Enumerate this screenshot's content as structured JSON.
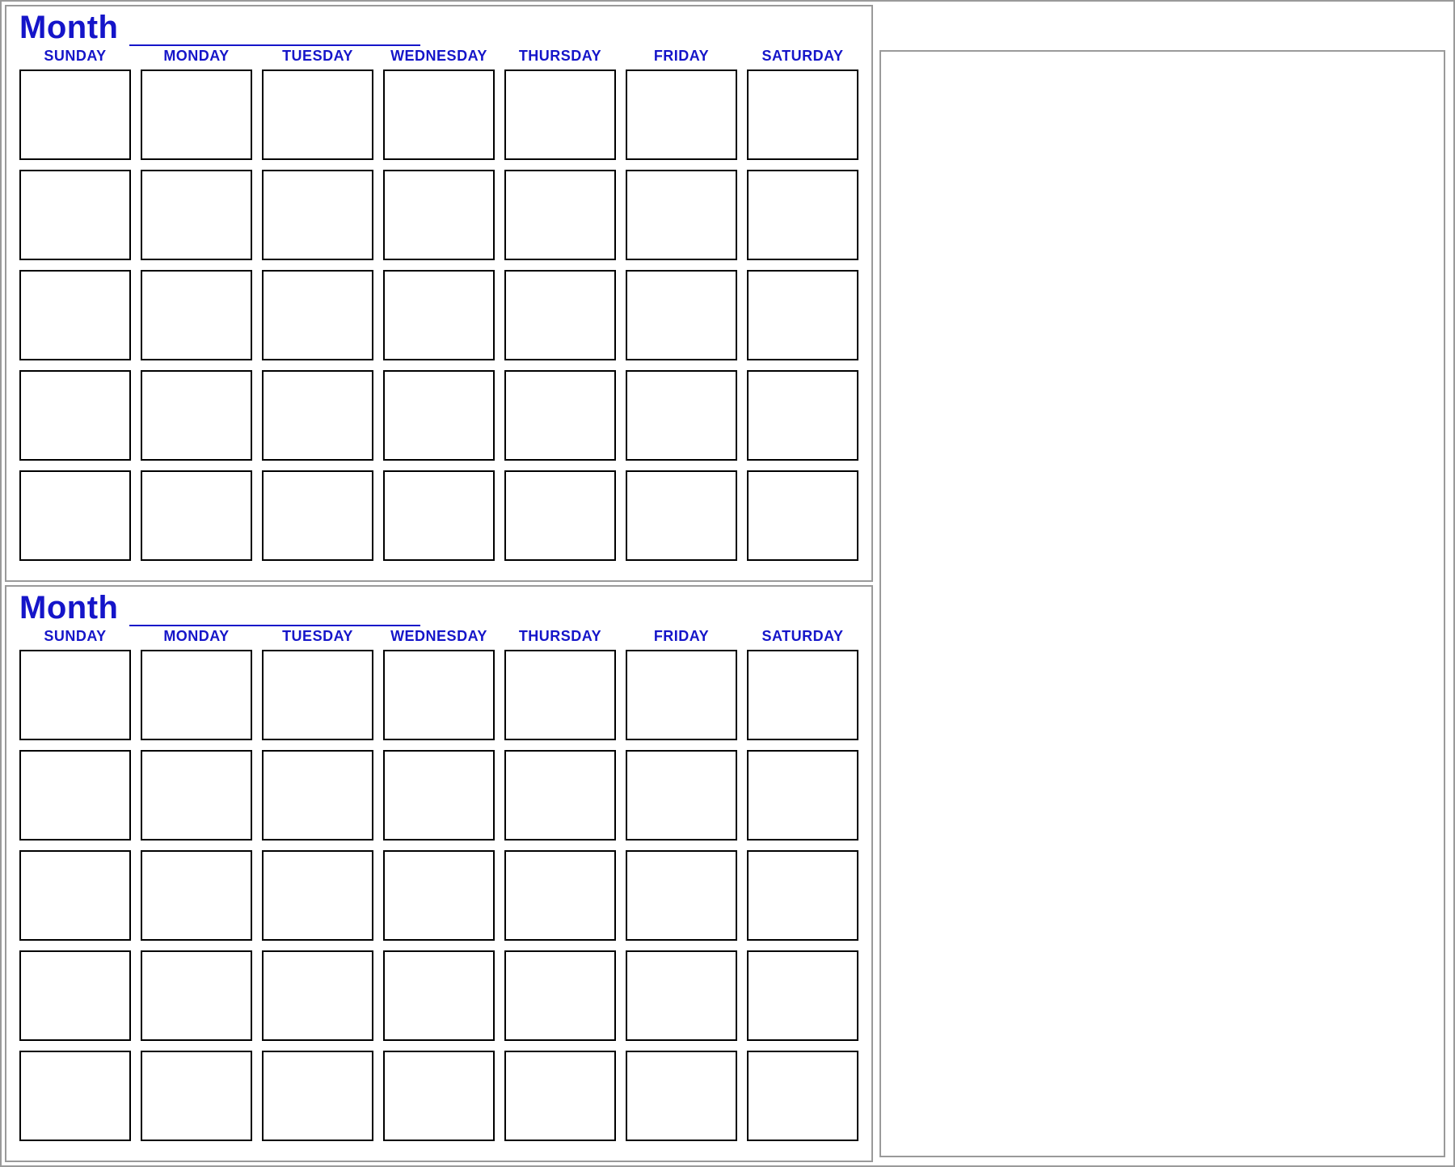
{
  "colors": {
    "accent": "#1515c9",
    "frame": "#9a9a9a",
    "cell_border": "#000000"
  },
  "month1": {
    "label": "Month",
    "name_value": "",
    "days": [
      "SUNDAY",
      "MONDAY",
      "TUESDAY",
      "WEDNESDAY",
      "THURSDAY",
      "FRIDAY",
      "SATURDAY"
    ],
    "rows": 5,
    "cols": 7
  },
  "month2": {
    "label": "Month",
    "name_value": "",
    "days": [
      "SUNDAY",
      "MONDAY",
      "TUESDAY",
      "WEDNESDAY",
      "THURSDAY",
      "FRIDAY",
      "SATURDAY"
    ],
    "rows": 5,
    "cols": 7
  },
  "notes": {
    "content": ""
  }
}
